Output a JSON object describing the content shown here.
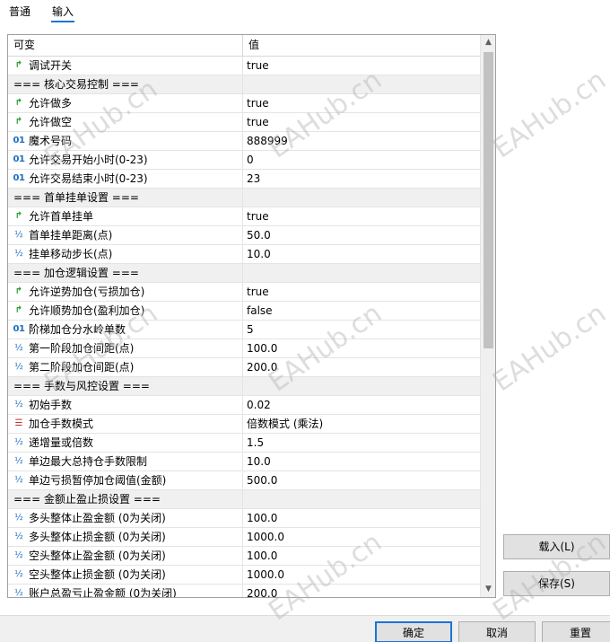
{
  "tabs": [
    {
      "label": "普通"
    },
    {
      "label": "输入"
    }
  ],
  "grid": {
    "headers": {
      "variable": "可变",
      "value": "值"
    },
    "rows": [
      {
        "type": "bool",
        "icon": "bool-arrow-icon",
        "label": "调试开关",
        "value": "true"
      },
      {
        "type": "section",
        "label": "=== 核心交易控制 ===",
        "value": ""
      },
      {
        "type": "bool",
        "icon": "bool-arrow-icon",
        "label": "允许做多",
        "value": "true"
      },
      {
        "type": "bool",
        "icon": "bool-arrow-icon",
        "label": "允许做空",
        "value": "true"
      },
      {
        "type": "int",
        "icon": "integer-icon",
        "label": "魔术号码",
        "value": "888999"
      },
      {
        "type": "int",
        "icon": "integer-icon",
        "label": "允许交易开始小时(0-23)",
        "value": "0"
      },
      {
        "type": "int",
        "icon": "integer-icon",
        "label": "允许交易结束小时(0-23)",
        "value": "23"
      },
      {
        "type": "section",
        "label": "=== 首单挂单设置 ===",
        "value": ""
      },
      {
        "type": "bool",
        "icon": "bool-arrow-icon",
        "label": "允许首单挂单",
        "value": "true"
      },
      {
        "type": "double",
        "icon": "double-icon",
        "label": "首单挂单距离(点)",
        "value": "50.0"
      },
      {
        "type": "double",
        "icon": "double-icon",
        "label": "挂单移动步长(点)",
        "value": "10.0"
      },
      {
        "type": "section",
        "label": "=== 加仓逻辑设置 ===",
        "value": ""
      },
      {
        "type": "bool",
        "icon": "bool-arrow-icon",
        "label": "允许逆势加仓(亏损加仓)",
        "value": "true"
      },
      {
        "type": "bool",
        "icon": "bool-arrow-icon",
        "label": "允许顺势加仓(盈利加仓)",
        "value": "false"
      },
      {
        "type": "int",
        "icon": "integer-icon",
        "label": "阶梯加仓分水岭单数",
        "value": "5"
      },
      {
        "type": "double",
        "icon": "double-icon",
        "label": "第一阶段加仓间距(点)",
        "value": "100.0"
      },
      {
        "type": "double",
        "icon": "double-icon",
        "label": "第二阶段加仓间距(点)",
        "value": "200.0"
      },
      {
        "type": "section",
        "label": "=== 手数与风控设置 ===",
        "value": ""
      },
      {
        "type": "double",
        "icon": "double-icon",
        "label": "初始手数",
        "value": "0.02"
      },
      {
        "type": "enum",
        "icon": "enum-icon",
        "label": "加仓手数模式",
        "value": "倍数模式 (乘法)"
      },
      {
        "type": "double",
        "icon": "double-icon",
        "label": "递增量或倍数",
        "value": "1.5"
      },
      {
        "type": "double",
        "icon": "double-icon",
        "label": "单边最大总持仓手数限制",
        "value": "10.0"
      },
      {
        "type": "double",
        "icon": "double-icon",
        "label": "单边亏损暂停加仓阈值(金额)",
        "value": "500.0"
      },
      {
        "type": "section",
        "label": "=== 金额止盈止损设置 ===",
        "value": ""
      },
      {
        "type": "double",
        "icon": "double-icon",
        "label": "多头整体止盈金额 (0为关闭)",
        "value": "100.0"
      },
      {
        "type": "double",
        "icon": "double-icon",
        "label": "多头整体止损金额 (0为关闭)",
        "value": "1000.0"
      },
      {
        "type": "double",
        "icon": "double-icon",
        "label": "空头整体止盈金额 (0为关闭)",
        "value": "100.0"
      },
      {
        "type": "double",
        "icon": "double-icon",
        "label": "空头整体止损金额 (0为关闭)",
        "value": "1000.0"
      },
      {
        "type": "double",
        "icon": "double-icon",
        "label": "账户总盈亏止盈金额 (0为关闭)",
        "value": "200.0"
      }
    ]
  },
  "icon_glyphs": {
    "bool": "↱",
    "int": "01",
    "double": "½",
    "enum": "☰"
  },
  "side_buttons": {
    "load": "载入(L)",
    "save": "保存(S)"
  },
  "bottom_buttons": {
    "ok": "确定",
    "cancel": "取消",
    "reset": "重置"
  },
  "watermark": "EAHub.cn",
  "colors": {
    "accent": "#1a73d9",
    "section_bg": "#f0f0f0",
    "bool_icon": "#2e9a2e",
    "int_icon": "#1c6fbf",
    "enum_icon": "#c03030"
  }
}
